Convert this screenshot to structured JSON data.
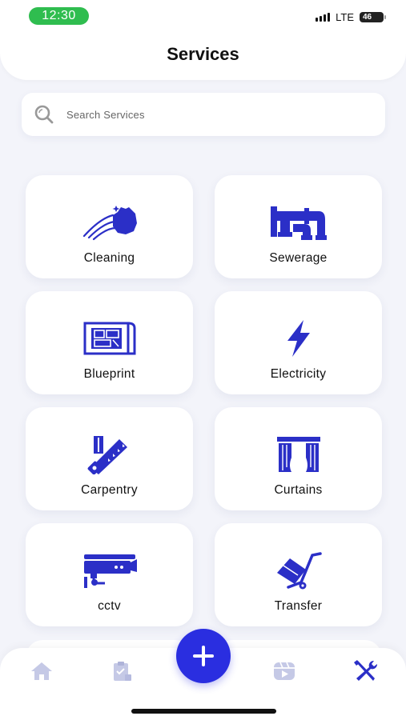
{
  "status_bar": {
    "time": "12:30",
    "network": "LTE",
    "battery": "46"
  },
  "header": {
    "title": "Services"
  },
  "search": {
    "placeholder": "Search Services",
    "value": ""
  },
  "services": [
    {
      "label": "Cleaning",
      "icon": "cleaning-icon"
    },
    {
      "label": "Sewerage",
      "icon": "pipe-icon"
    },
    {
      "label": "Blueprint",
      "icon": "blueprint-icon"
    },
    {
      "label": "Electricity",
      "icon": "lightning-icon"
    },
    {
      "label": "Carpentry",
      "icon": "saw-icon"
    },
    {
      "label": "Curtains",
      "icon": "curtains-icon"
    },
    {
      "label": "cctv",
      "icon": "cctv-camera-icon"
    },
    {
      "label": "Transfer",
      "icon": "hand-truck-icon"
    }
  ],
  "tab_bar": {
    "items": [
      {
        "icon": "home-icon",
        "active": false
      },
      {
        "icon": "clipboard-icon",
        "active": false
      },
      {
        "icon": "add-icon",
        "active": false
      },
      {
        "icon": "video-icon",
        "active": false
      },
      {
        "icon": "tools-icon",
        "active": true
      }
    ]
  },
  "colors": {
    "accent": "#2a2ee0",
    "icon": "#2b2fc7",
    "inactive": "#c5c9e6",
    "status_green": "#2fbd4f",
    "background": "#f3f4fa"
  }
}
